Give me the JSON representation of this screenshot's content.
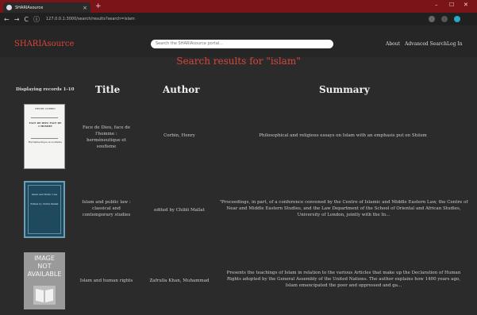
{
  "browser": {
    "tab_title": "SHARIAsource",
    "tab_close": "×",
    "new_tab": "+",
    "url": "127.0.0.1:3000/search/results?search=islam",
    "back": "←",
    "forward": "→",
    "reload": "C",
    "info": "ⓘ",
    "minimize": "–",
    "maximize": "☐",
    "close": "✕"
  },
  "site": {
    "logo": "SHARIAsource",
    "search_placeholder": "Search the SHARIAsource portal...",
    "links": [
      "About",
      "Advanced Search",
      "Log In"
    ]
  },
  "results_title": "Search results for \"islam\"",
  "display_count": "Displaying records 1-10",
  "columns": {
    "title": "Title",
    "author": "Author",
    "summary": "Summary"
  },
  "results": [
    {
      "title": "Face de Dieu, face de l'homme : herméneutique et soufisme",
      "author": "Corbin, Henry",
      "summary": "Philosophical and religious essays on Islam with an emphasis put on Shiism",
      "cover": {
        "top": "HENRY CORBIN",
        "main": "FACE DE DIEU FACE DE L'HOMME",
        "sub": "Herméneutique et soufisme"
      }
    },
    {
      "title": "Islam and public law : classical and contemporary studies",
      "author": "edited by Chibli Mallat",
      "summary": "\"Proceedings, in part, of a conference convened by the Centre of Islamic and Middle Eastern Law, the Centre of Near and Middle Eastern Studies, and the Law Department of the School of Oriental and African Studies, University of London, jointly with the In...",
      "cover": {
        "main": "Islam and Public Law",
        "sub": "Edited by Chibli Mallat"
      }
    },
    {
      "title": "Islam and human rights",
      "author": "Zafrulla Khan, Muhammad",
      "summary": "Presents the teachings of Islam in relation to the various Articles that make up the Declaration of Human Rights adopted by the General Assembly of the United Nations. The author explains how 1400 years ago, Islam emancipated the poor and oppressed and ga...",
      "cover": {
        "placeholder": [
          "IMAGE",
          "NOT",
          "AVAILABLE"
        ]
      }
    }
  ],
  "colors": {
    "chrome_top": "#7a1418",
    "accent": "#d9453b",
    "page_bg": "#2b2b2b"
  }
}
